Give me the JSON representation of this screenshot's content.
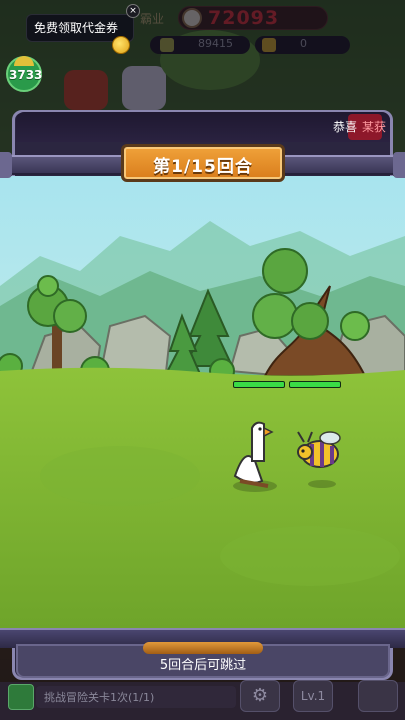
{
  "lobby": {
    "header_label": "霸业",
    "coins": "72093",
    "stat_a": "89415",
    "stat_b": "0",
    "promo_text": "免费领取代金券",
    "promo_close": "×",
    "level_value": "3733"
  },
  "panel": {
    "congrats_label": "恭喜",
    "congrats_tag": "某获",
    "round_label": "第1/15回合",
    "skip_hint": "5回合后可跳过"
  },
  "battle": {
    "goose_hp": 1.0,
    "bee_hp": 1.0
  },
  "bottom": {
    "task_text": "挑战冒险关卡1次(1/1)",
    "gear_icon": "⚙",
    "level_button": "Lv.1"
  },
  "colors": {
    "accent_orange": "#e88e2a",
    "hp_green": "#3adb46",
    "panel_border": "#8a86b0",
    "coin_red": "#d0323a"
  }
}
